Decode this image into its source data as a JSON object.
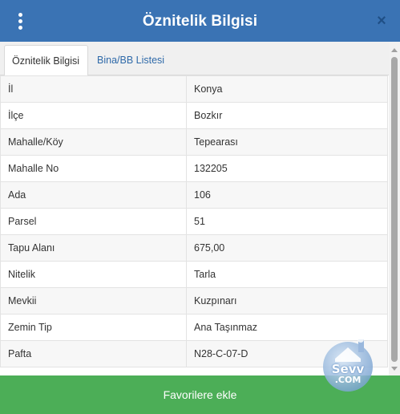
{
  "header": {
    "title": "Öznitelik Bilgisi",
    "menu_icon": "more-vertical-icon",
    "close_icon": "close-icon",
    "close_glyph": "×",
    "background_color": "#3a73b4"
  },
  "tabs": [
    {
      "label": "Öznitelik Bilgisi",
      "active": true
    },
    {
      "label": "Bina/BB Listesi",
      "active": false
    }
  ],
  "attributes": [
    {
      "key": "İl",
      "value": "Konya"
    },
    {
      "key": "İlçe",
      "value": "Bozkır"
    },
    {
      "key": "Mahalle/Köy",
      "value": "Tepearası"
    },
    {
      "key": "Mahalle No",
      "value": "132205"
    },
    {
      "key": "Ada",
      "value": "106"
    },
    {
      "key": "Parsel",
      "value": "51"
    },
    {
      "key": "Tapu Alanı",
      "value": "675,00"
    },
    {
      "key": "Nitelik",
      "value": "Tarla"
    },
    {
      "key": "Mevkii",
      "value": "Kuzpınarı"
    },
    {
      "key": "Zemin Tip",
      "value": "Ana Taşınmaz"
    },
    {
      "key": "Pafta",
      "value": "N28-C-07-D"
    }
  ],
  "footer": {
    "button_label": "Favorilere ekle",
    "button_color": "#4cae57"
  },
  "watermark": {
    "line1": "Sevv",
    "line2": ".COM"
  }
}
